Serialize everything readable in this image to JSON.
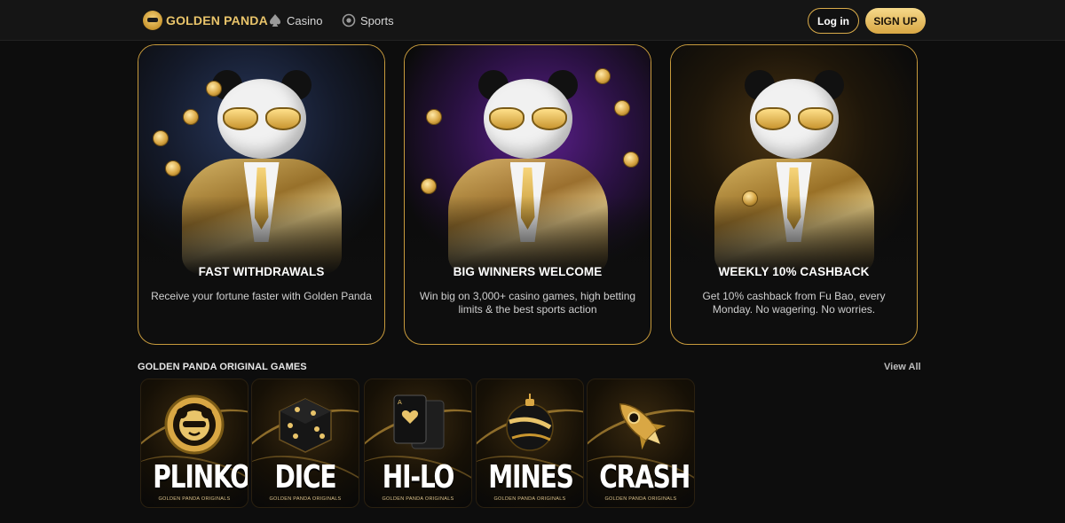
{
  "header": {
    "brand": "GOLDEN PANDA",
    "nav": [
      {
        "label": "Casino",
        "icon": "spade-icon"
      },
      {
        "label": "Sports",
        "icon": "ball-icon"
      }
    ],
    "login_label": "Log in",
    "signup_label": "SIGN UP"
  },
  "promos": [
    {
      "title": "FAST WITHDRAWALS",
      "description": "Receive your fortune faster with Golden Panda"
    },
    {
      "title": "BIG WINNERS WELCOME",
      "description": "Win big on 3,000+ casino games, high betting limits & the best sports action"
    },
    {
      "title": "WEEKLY 10% CASHBACK",
      "description": "Get 10% cashback from Fu Bao, every Monday. No wagering. No worries."
    }
  ],
  "originals": {
    "title": "GOLDEN PANDA ORIGINAL GAMES",
    "view_all": "View All",
    "games": [
      {
        "name": "PLINKO",
        "subtitle": "GOLDEN PANDA ORIGINALS",
        "icon": "panda-chip-icon"
      },
      {
        "name": "DICE",
        "subtitle": "GOLDEN PANDA ORIGINALS",
        "icon": "dice-icon"
      },
      {
        "name": "HI-LO",
        "subtitle": "GOLDEN PANDA ORIGINALS",
        "icon": "cards-icon"
      },
      {
        "name": "MINES",
        "subtitle": "GOLDEN PANDA ORIGINALS",
        "icon": "mine-icon"
      },
      {
        "name": "CRASH",
        "subtitle": "GOLDEN PANDA ORIGINALS",
        "icon": "rocket-icon"
      }
    ]
  },
  "colors": {
    "accent_gold": "#d9ab4a",
    "background": "#0d0d0d",
    "header": "#151515"
  }
}
